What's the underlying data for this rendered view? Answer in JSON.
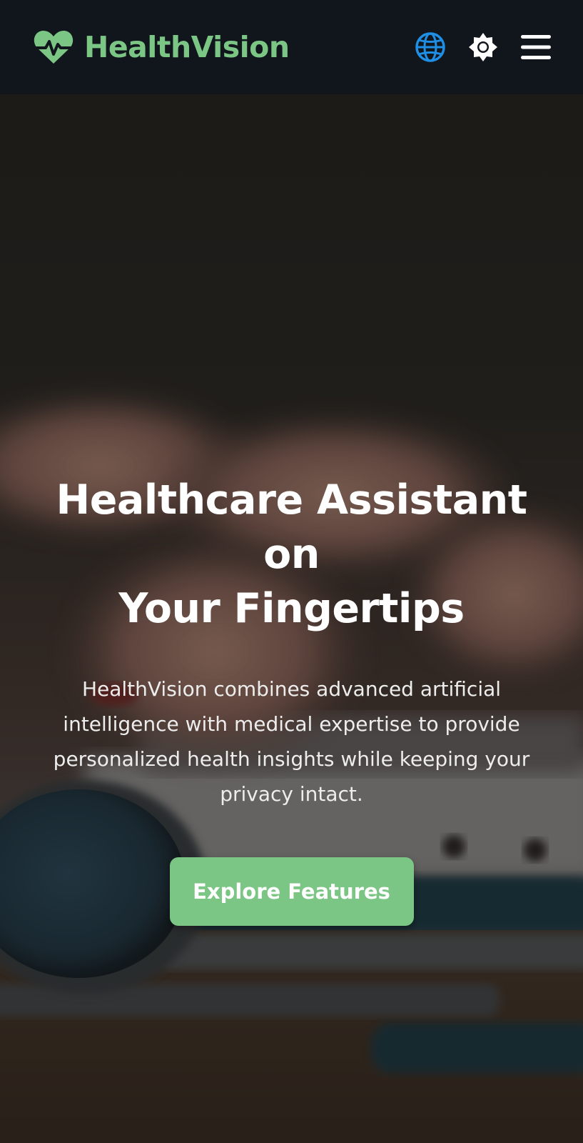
{
  "header": {
    "brand_name": "HealthVision",
    "icons": {
      "logo": "heart-pulse-icon",
      "language": "globe-icon",
      "theme": "sun-icon",
      "menu": "hamburger-menu-icon"
    }
  },
  "hero": {
    "title_line1": "Healthcare Assistant on",
    "title_line2": "Your Fingertips",
    "description": "HealthVision combines advanced artificial intelligence with medical expertise to provide personalized health insights while keeping your privacy intact.",
    "cta_label": "Explore Features",
    "background": "blurred photo of hands typing on a laptop keyboard with a stethoscope in the foreground"
  },
  "colors": {
    "brand_green": "#7bc585",
    "header_bg": "#11151c",
    "globe_blue": "#1f8fe5",
    "text_white": "#ffffff"
  }
}
